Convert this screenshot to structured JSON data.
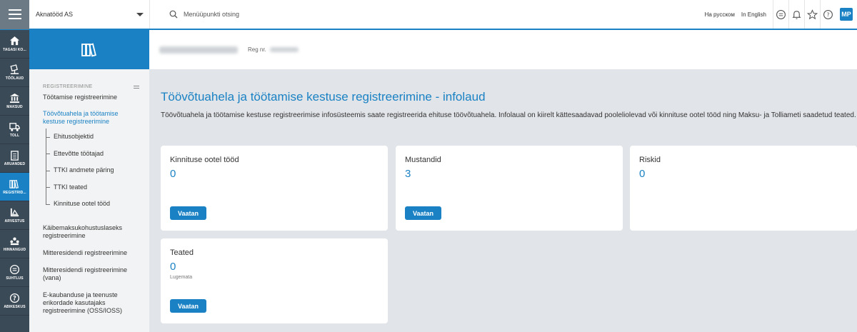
{
  "topbar": {
    "company": "Aknatööd AS",
    "search_placeholder": "Menüüpunkti otsing",
    "lang_ru": "На русском",
    "lang_en": "In English",
    "avatar": "MP",
    "icons": [
      "chat-icon",
      "bell-icon",
      "star-icon",
      "help-icon"
    ]
  },
  "rail": {
    "items": [
      {
        "label": "TAGASI KO...",
        "icon": "home-icon"
      },
      {
        "label": "TÖÖLAUD",
        "icon": "desk-icon"
      },
      {
        "label": "MAKSUD",
        "icon": "bank-icon"
      },
      {
        "label": "TOLL",
        "icon": "truck-icon"
      },
      {
        "label": "ARUANDED",
        "icon": "report-icon"
      },
      {
        "label": "REGISTRID...",
        "icon": "registry-icon",
        "active": true
      },
      {
        "label": "ARVESTUS",
        "icon": "accounting-icon"
      },
      {
        "label": "HINNANGUD",
        "icon": "rating-icon"
      },
      {
        "label": "SUHTLUS",
        "icon": "communication-icon"
      },
      {
        "label": "ABIKESKUS",
        "icon": "help-center-icon"
      }
    ]
  },
  "nav": {
    "section": "REGISTREERIMINE",
    "items": [
      "Töötamise registreerimine",
      "Töövõtuahela ja töötamise kestuse registreerimine",
      "Käibemaksukohustuslaseks registreerimine",
      "Mitteresidendi registreerimine",
      "Mitteresidendi registreerimine (vana)",
      "E-kaubanduse ja teenuste erikordade kasutajaks registreerimine (OSS/IOSS)"
    ],
    "subitems": [
      "Ehitusobjektid",
      "Ettevõtte töötajad",
      "TTKI andmete päring",
      "TTKI teated",
      "Kinnituse ootel tööd"
    ]
  },
  "main": {
    "reg_label": "Reg nr.",
    "title": "Töövõtuahela ja töötamise kestuse registreerimine - infolaud",
    "description": "Töövõtuahela ja töötamise kestuse registreerimise infosüsteemis saate registreerida ehituse töövõtuahela. Infolaual on kiirelt kättesaadavad pooleliolevad või kinnituse ootel tööd ning Maksu- ja Tolliameti saadetud teated.",
    "cards": [
      {
        "title": "Kinnituse ootel tööd",
        "value": "0",
        "button": "Vaatan"
      },
      {
        "title": "Mustandid",
        "value": "3",
        "button": "Vaatan"
      },
      {
        "title": "Riskid",
        "value": "0"
      },
      {
        "title": "Teated",
        "value": "0",
        "sub": "Lugemata",
        "button": "Vaatan"
      }
    ]
  },
  "colors": {
    "accent": "#1a82c4",
    "rail": "#3b4a57",
    "background": "#e1e4e8"
  }
}
